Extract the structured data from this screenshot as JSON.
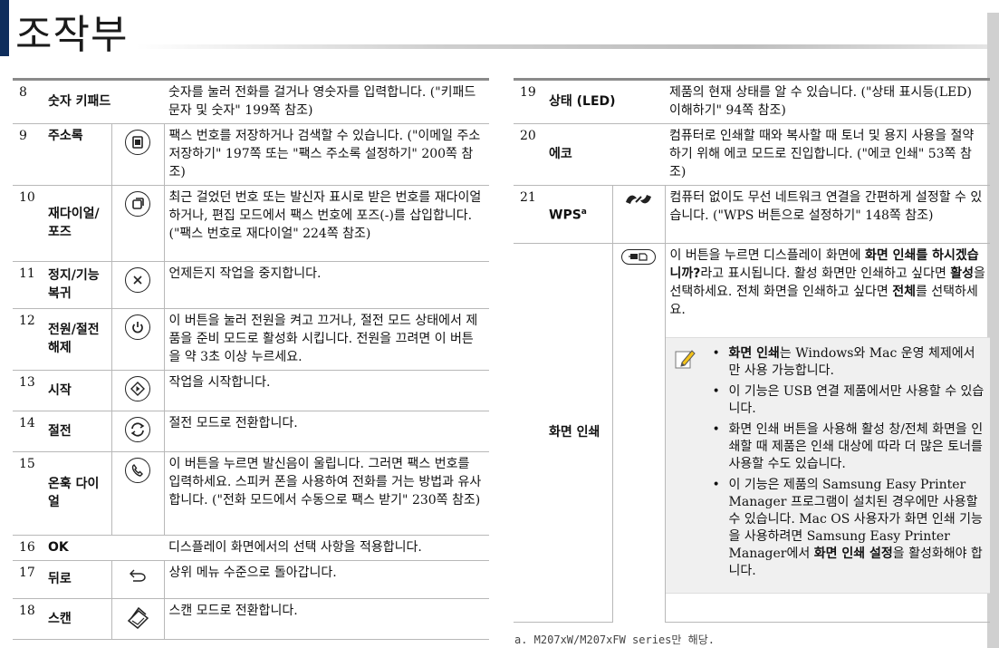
{
  "page": {
    "title": "조작부"
  },
  "left_rows": [
    {
      "num": "8",
      "name": "숫자 키패드",
      "icon": "",
      "desc": "숫자를 눌러 전화를 걸거나 영숫자를 입력합니다. (\"키패드 문자 및 숫자\" 199쪽 참조)"
    },
    {
      "num": "9",
      "name": "주소록",
      "icon": "address-book-icon",
      "desc": "팩스 번호를 저장하거나 검색할 수 있습니다. (\"이메일 주소 저장하기\" 197쪽 또는 \"팩스 주소록 설정하기\" 200쪽 참조)"
    },
    {
      "num": "10",
      "name": "재다이얼/포즈",
      "icon": "redial-pause-icon",
      "desc": "최근 걸었던 번호 또는 발신자 표시로 받은 번호를 재다이얼하거나, 편집 모드에서 팩스 번호에 포즈(-)를 삽입합니다. (\"팩스 번호로 재다이얼\" 224쪽 참조)"
    },
    {
      "num": "11",
      "name": "정지/기능복귀",
      "icon": "stop-clear-icon",
      "desc": "언제든지 작업을 중지합니다."
    },
    {
      "num": "12",
      "name": "전원/절전해제",
      "icon": "power-icon",
      "desc": "이 버튼을 눌러 전원을 켜고 끄거나, 절전 모드 상태에서 제품을 준비 모드로 활성화 시킵니다. 전원을 끄려면 이 버튼을 약 3초 이상 누르세요."
    },
    {
      "num": "13",
      "name": "시작",
      "icon": "start-icon",
      "desc": "작업을 시작합니다."
    },
    {
      "num": "14",
      "name": "절전",
      "icon": "eco-power-save-icon",
      "desc": "절전 모드로 전환합니다."
    },
    {
      "num": "15",
      "name": "온훅 다이얼",
      "icon": "on-hook-dial-icon",
      "desc": "이 버튼을 누르면 발신음이 울립니다. 그러면 팩스 번호를 입력하세요. 스피커 폰을 사용하여 전화를 거는 방법과 유사합니다. (\"전화 모드에서 수동으로 팩스 받기\" 230쪽 참조)"
    },
    {
      "num": "16",
      "name": "OK",
      "icon": "",
      "desc": "디스플레이 화면에서의 선택 사항을 적용합니다."
    },
    {
      "num": "17",
      "name": "뒤로",
      "icon": "back-icon",
      "desc": "상위 메뉴 수준으로 돌아갑니다."
    },
    {
      "num": "18",
      "name": "스캔",
      "icon": "scan-icon",
      "desc": "스캔 모드로 전환합니다."
    }
  ],
  "right_rows": {
    "r19": {
      "num": "19",
      "name": "상태 (LED)",
      "desc": "제품의 현재 상태를 알 수 있습니다. (\"상태 표시등(LED) 이해하기\" 94쪽 참조)"
    },
    "r20": {
      "num": "20",
      "name": "에코",
      "desc": "컴퓨터로 인쇄할 때와 복사할 때 토너 및 용지 사용을 절약하기 위해 에코 모드로 진입합니다. (\"에코 인쇄\" 53쪽 참조)"
    },
    "r21": {
      "num": "21",
      "name": "WPS",
      "name_sup": "a",
      "icon": "wps-icon",
      "desc": "컴퓨터 없이도 무선 네트워크 연결을 간편하게 설정할 수 있습니다. (\"WPS 버튼으로 설정하기\" 148쪽 참조)"
    },
    "print_screen": {
      "name": "화면 인쇄",
      "icon": "print-screen-icon",
      "desc_1": "이 버튼을 누르면 디스플레이 화면에 ",
      "desc_bold_1": "화면 인쇄를 하시겠습니까?",
      "desc_2": "라고 표시됩니다. 활성 화면만 인쇄하고 싶다면 ",
      "desc_bold_2": "활성",
      "desc_3": "을 선택하세요. 전체 화면을 인쇄하고 싶다면 ",
      "desc_bold_3": "전체",
      "desc_4": "를 선택하세요.",
      "notes": {
        "n1_bold": "화면 인쇄",
        "n1_text": "는 Windows와 Mac 운영 체제에서만 사용 가능합니다.",
        "n2_text": "이 기능은 USB 연결 제품에서만 사용할 수 있습니다.",
        "n3_text": "화면 인쇄 버튼을 사용해 활성 창/전체 화면을 인쇄할 때 제품은 인쇄 대상에 따라 더 많은 토너를 사용할 수도 있습니다.",
        "n4_text_1": "이 기능은 제품의 Samsung Easy Printer Manager 프로그램이 설치된 경우에만 사용할 수 있습니다. Mac OS 사용자가 화면 인쇄 기능을 사용하려면 Samsung Easy Printer Manager에서 ",
        "n4_bold": "화면 인쇄 설정",
        "n4_text_2": "을 활성화해야 합니다."
      }
    }
  },
  "footnote": "a. M207xW/M207xFW series만 해당."
}
